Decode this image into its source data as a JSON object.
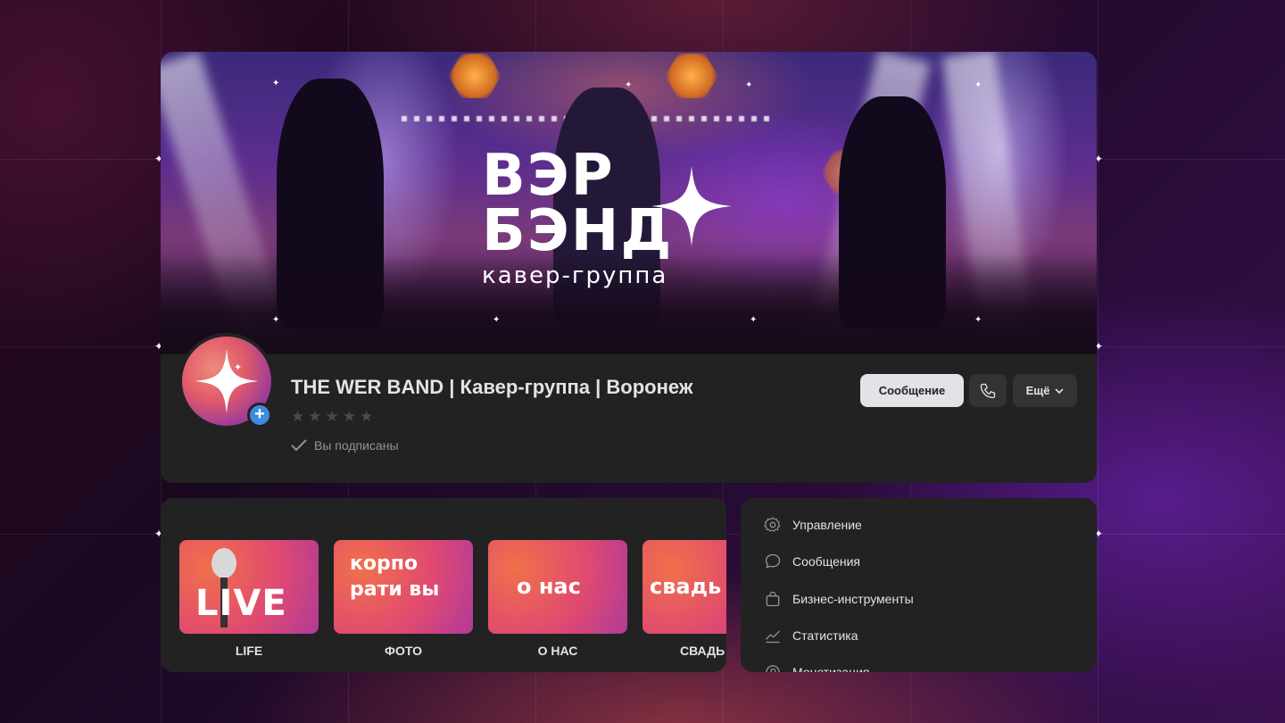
{
  "cover": {
    "logo_line1": "ВЭР",
    "logo_line2": "БЭНД",
    "logo_sub": "кавер-группа"
  },
  "profile": {
    "title": "THE WER BAND | Кавер-группа | Воронеж",
    "rating_stars": 0,
    "subscribed_label": "Вы подписаны",
    "message_button": "Сообщение",
    "more_button": "Ещё"
  },
  "stories": [
    {
      "label": "LIFE",
      "card_text": "LIVE"
    },
    {
      "label": "ФОТО",
      "card_text": "корпо рати вы"
    },
    {
      "label": "О НАС",
      "card_text": "о нас"
    },
    {
      "label": "СВАДЬ",
      "card_text": "свадь"
    }
  ],
  "menu": {
    "items": [
      {
        "label": "Управление",
        "icon": "gear-icon"
      },
      {
        "label": "Сообщения",
        "icon": "chat-bubble-icon"
      },
      {
        "label": "Бизнес-инструменты",
        "icon": "shopping-bag-icon"
      },
      {
        "label": "Статистика",
        "icon": "trend-chart-icon"
      },
      {
        "label": "Монетизация",
        "icon": "coin-icon"
      }
    ]
  },
  "colors": {
    "accent": "#3f8ae0",
    "panel": "#222222",
    "button_light": "#e1e3e6"
  }
}
